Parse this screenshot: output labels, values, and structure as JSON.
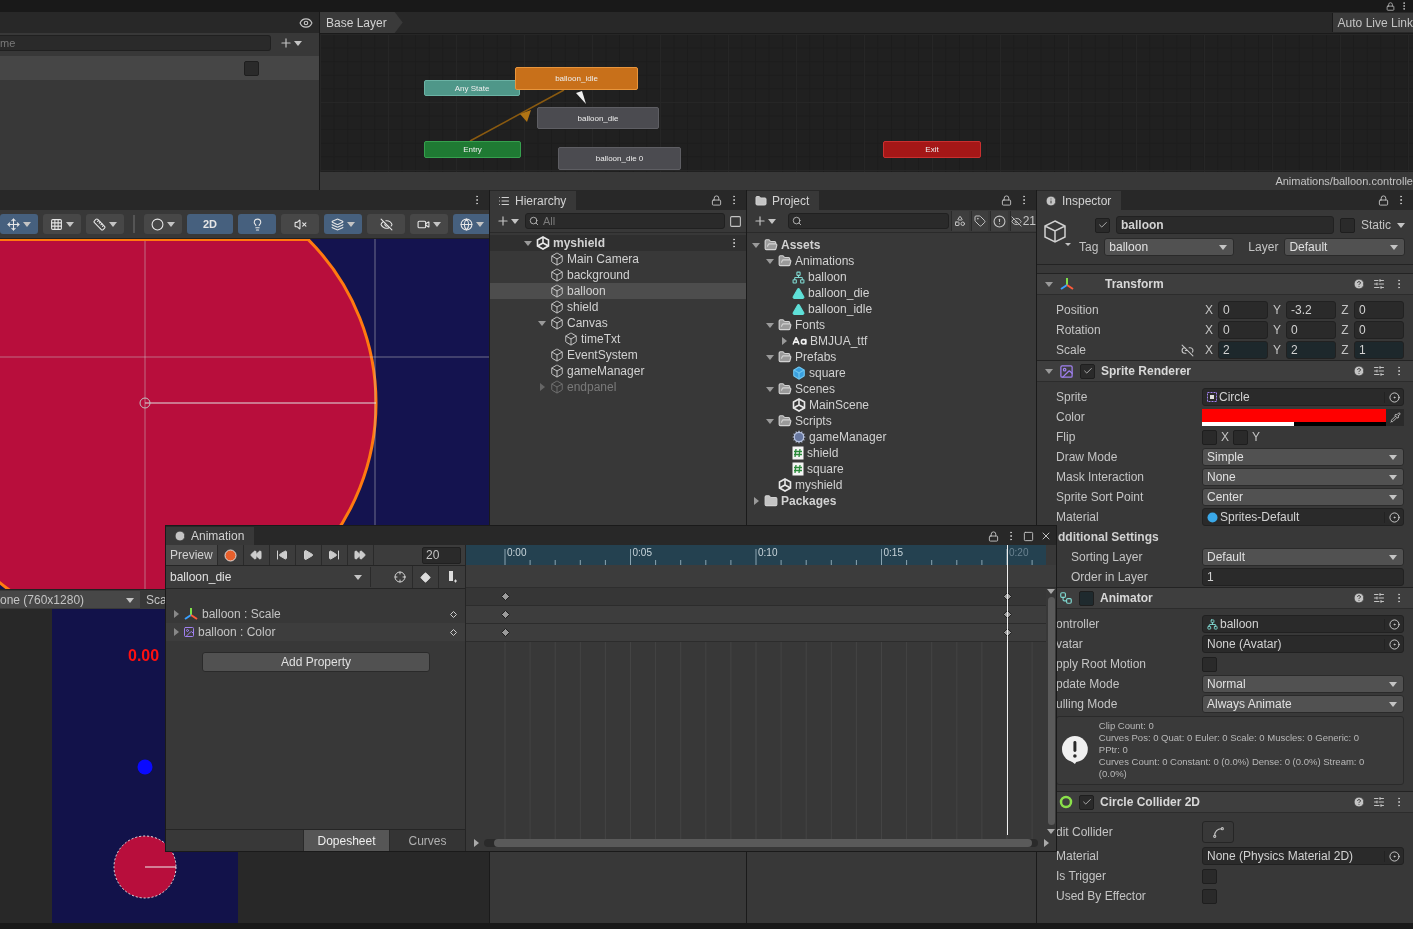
{
  "parameters": {
    "search_placeholder": "me",
    "param_checked": false
  },
  "animator": {
    "breadcrumb": "Base Layer",
    "live_link_button": "Auto Live Link",
    "path": "Animations/balloon.controlle",
    "nodes": [
      {
        "kind": "any",
        "label": "Any State"
      },
      {
        "kind": "default",
        "label": "balloon_idle"
      },
      {
        "kind": "state",
        "label": "balloon_die"
      },
      {
        "kind": "entry",
        "label": "Entry"
      },
      {
        "kind": "state",
        "label": "balloon_die 0"
      },
      {
        "kind": "exit",
        "label": "Exit"
      }
    ]
  },
  "scene": {
    "toolbar": [
      {
        "kind": "transform",
        "on": true
      },
      {
        "kind": "snap",
        "on": false
      },
      {
        "kind": "ruler",
        "on": false
      },
      {
        "kind": "shading",
        "on": false
      },
      {
        "kind": "mode2d",
        "label": "2D",
        "on": true
      },
      {
        "kind": "light",
        "on": true
      },
      {
        "kind": "audio",
        "on": false
      },
      {
        "kind": "effects",
        "on": true
      },
      {
        "kind": "visibility",
        "on": false
      },
      {
        "kind": "camera",
        "on": false
      },
      {
        "kind": "gizmos",
        "on": true
      }
    ]
  },
  "game": {
    "resolution": "one (760x1280)",
    "scale_label": "Sca",
    "score": "0.00"
  },
  "hierarchy": {
    "title": "Hierarchy",
    "search_placeholder": "All",
    "tree": [
      {
        "label": "myshield",
        "kind": "scene",
        "expanded": true,
        "selected": false,
        "active": true,
        "children": [
          {
            "label": "Main Camera",
            "kind": "object",
            "selected": false,
            "active": true
          },
          {
            "label": "background",
            "kind": "object",
            "selected": false,
            "active": true
          },
          {
            "label": "balloon",
            "kind": "object",
            "selected": true,
            "active": true
          },
          {
            "label": "shield",
            "kind": "object",
            "selected": false,
            "active": true
          },
          {
            "label": "Canvas",
            "kind": "object",
            "expanded": true,
            "selected": false,
            "active": true,
            "children": [
              {
                "label": "timeTxt",
                "kind": "object",
                "selected": false,
                "active": true
              }
            ]
          },
          {
            "label": "EventSystem",
            "kind": "object",
            "selected": false,
            "active": true
          },
          {
            "label": "gameManager",
            "kind": "object",
            "selected": false,
            "active": true
          },
          {
            "label": "endpanel",
            "kind": "object",
            "expanded": false,
            "selected": false,
            "active": false
          }
        ]
      }
    ]
  },
  "project": {
    "title": "Project",
    "hidden_count": "21",
    "tree": [
      {
        "label": "Assets",
        "kind": "folder",
        "expanded": true,
        "children": [
          {
            "label": "Animations",
            "kind": "folder",
            "expanded": true,
            "children": [
              {
                "label": "balloon",
                "kind": "controller"
              },
              {
                "label": "balloon_die",
                "kind": "clip"
              },
              {
                "label": "balloon_idle",
                "kind": "clip"
              }
            ]
          },
          {
            "label": "Fonts",
            "kind": "folder",
            "expanded": true,
            "children": [
              {
                "label": "BMJUA_ttf",
                "kind": "font",
                "expanded": false
              }
            ]
          },
          {
            "label": "Prefabs",
            "kind": "folder",
            "expanded": true,
            "children": [
              {
                "label": "square",
                "kind": "prefab"
              }
            ]
          },
          {
            "label": "Scenes",
            "kind": "folder",
            "expanded": true,
            "children": [
              {
                "label": "MainScene",
                "kind": "scene"
              }
            ]
          },
          {
            "label": "Scripts",
            "kind": "folder",
            "expanded": true,
            "children": [
              {
                "label": "gameManager",
                "kind": "manager"
              },
              {
                "label": "shield",
                "kind": "script"
              },
              {
                "label": "square",
                "kind": "script"
              }
            ]
          },
          {
            "label": "myshield",
            "kind": "scene"
          }
        ]
      },
      {
        "label": "Packages",
        "kind": "folder",
        "expanded": false
      }
    ]
  },
  "inspector": {
    "title": "Inspector",
    "object": {
      "active": true,
      "name": "balloon",
      "static": false,
      "static_label": "Static",
      "tag_label": "Tag",
      "tag": "balloon",
      "layer_label": "Layer",
      "layer": "Default"
    },
    "components": [
      {
        "kind": "transform",
        "title": "Transform",
        "props": [
          {
            "kind": "vector3",
            "label": "Position",
            "animated": false,
            "values": [
              {
                "axis": "X",
                "value": "0"
              },
              {
                "axis": "Y",
                "value": "-3.2"
              },
              {
                "axis": "Z",
                "value": "0"
              }
            ]
          },
          {
            "kind": "vector3",
            "label": "Rotation",
            "animated": false,
            "values": [
              {
                "axis": "X",
                "value": "0"
              },
              {
                "axis": "Y",
                "value": "0"
              },
              {
                "axis": "Z",
                "value": "0"
              }
            ]
          },
          {
            "kind": "vector3",
            "label": "Scale",
            "animated": true,
            "values": [
              {
                "axis": "X",
                "value": "2"
              },
              {
                "axis": "Y",
                "value": "2"
              },
              {
                "axis": "Z",
                "value": "1"
              }
            ]
          }
        ]
      },
      {
        "kind": "sprite",
        "title": "Sprite Renderer",
        "enabled": true,
        "props": [
          {
            "kind": "object",
            "label": "Sprite",
            "value": "Circle"
          },
          {
            "kind": "color",
            "label": "Color",
            "color": "#ff0000",
            "level": 0.5
          },
          {
            "kind": "flip",
            "label": "Flip",
            "options": [
              {
                "label": "X",
                "checked": false
              },
              {
                "label": "Y",
                "checked": false
              }
            ]
          },
          {
            "kind": "dropdown",
            "label": "Draw Mode",
            "value": "Simple"
          },
          {
            "kind": "dropdown",
            "label": "Mask Interaction",
            "value": "None"
          },
          {
            "kind": "dropdown",
            "label": "Sprite Sort Point",
            "value": "Center"
          },
          {
            "kind": "object",
            "label": "Material",
            "value": "Sprites-Default"
          },
          {
            "kind": "section",
            "label": "dditional Settings"
          },
          {
            "kind": "dropdown",
            "label": "Sorting Layer",
            "value": "Default",
            "indent": true
          },
          {
            "kind": "number",
            "label": "Order in Layer",
            "value": "1",
            "indent": true
          }
        ]
      },
      {
        "kind": "animator",
        "title": "Animator",
        "enabled": false,
        "props": [
          {
            "kind": "object",
            "label": "ontroller",
            "value": "balloon"
          },
          {
            "kind": "object",
            "label": "vatar",
            "value": "None (Avatar)"
          },
          {
            "kind": "checkbox",
            "label": "pply Root Motion",
            "checked": false
          },
          {
            "kind": "dropdown",
            "label": "pdate Mode",
            "value": "Normal"
          },
          {
            "kind": "dropdown",
            "label": "ulling Mode",
            "value": "Always Animate"
          },
          {
            "kind": "info",
            "lines": [
              "Clip Count: 0",
              "Curves Pos: 0 Quat: 0 Euler: 0 Scale: 0 Muscles: 0 Generic: 0",
              "PPtr: 0",
              "Curves Count: 0 Constant: 0 (0.0%) Dense: 0 (0.0%) Stream: 0 (0.0%)"
            ]
          }
        ]
      },
      {
        "kind": "collider",
        "title": "Circle Collider 2D",
        "enabled": true,
        "props": [
          {
            "kind": "button",
            "label": "dit Collider"
          },
          {
            "kind": "object",
            "label": "Material",
            "value": "None (Physics Material 2D)"
          },
          {
            "kind": "checkbox",
            "label": "Is Trigger",
            "checked": false
          },
          {
            "kind": "checkbox",
            "label": "Used By Effector",
            "checked": false
          }
        ]
      }
    ]
  },
  "animation": {
    "title": "Animation",
    "preview": "Preview",
    "frame": "20",
    "clip": "balloon_die",
    "properties": [
      {
        "kind": "transform",
        "label": "balloon : Scale"
      },
      {
        "kind": "sprite",
        "label": "balloon : Color"
      }
    ],
    "add_property": "Add Property",
    "tabs": [
      {
        "label": "Dopesheet",
        "selected": true
      },
      {
        "label": "Curves",
        "selected": false
      }
    ],
    "ticks": [
      "0:00",
      "0:05",
      "0:10",
      "0:15",
      "0:20"
    ],
    "playhead": {
      "level": 1
    }
  }
}
